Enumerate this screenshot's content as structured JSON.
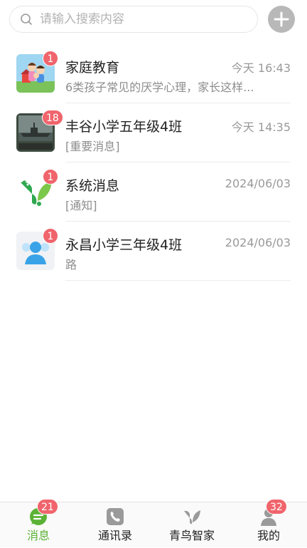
{
  "search": {
    "placeholder": "请输入搜索内容"
  },
  "conversations": [
    {
      "title": "家庭教育",
      "time": "今天 16:43",
      "subtitle": "6类孩子常见的厌学心理，家长这样...",
      "badge": "1",
      "avatar": "family-cartoon-avatar"
    },
    {
      "title": "丰谷小学五年级4班",
      "time": "今天 14:35",
      "subtitle": "[重要消息]",
      "badge": "18",
      "avatar": "warship-photo-avatar"
    },
    {
      "title": "系统消息",
      "time": "2024/06/03",
      "subtitle": "[通知]",
      "badge": "1",
      "avatar": "green-bird-logo-avatar"
    },
    {
      "title": "永昌小学三年级4班",
      "time": "2024/06/03",
      "subtitle": "路",
      "badge": "1",
      "avatar": "group-person-avatar"
    }
  ],
  "tabbar": {
    "tabs": [
      {
        "label": "消息",
        "badge": "21",
        "icon": "chat-icon",
        "active": true
      },
      {
        "label": "通讯录",
        "icon": "phone-book-icon"
      },
      {
        "label": "青鸟智家",
        "icon": "bird-leaf-icon"
      },
      {
        "label": "我的",
        "badge": "32",
        "icon": "person-icon"
      }
    ]
  },
  "colors": {
    "accent": "#5bb236",
    "badge": "#f0646c",
    "muted": "#999999"
  }
}
